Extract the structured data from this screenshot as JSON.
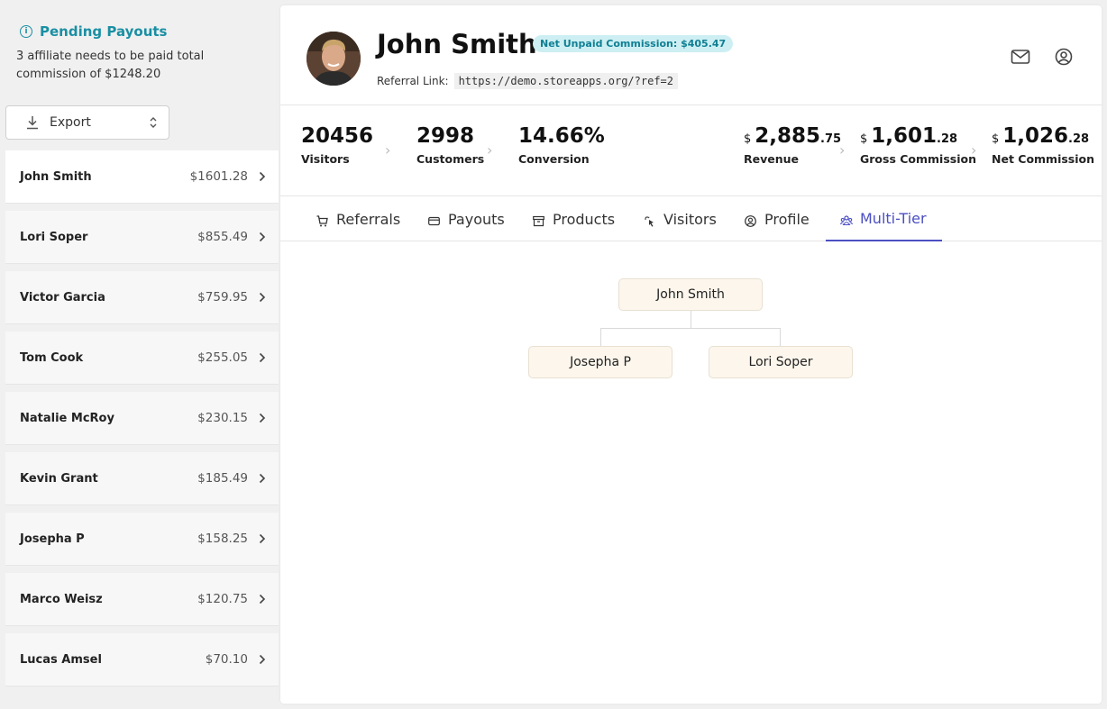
{
  "sidebar": {
    "pending_title": "Pending Payouts",
    "pending_desc": "3 affiliate needs to be paid total commission of $1248.20",
    "export_label": "Export",
    "affiliates": [
      {
        "name": "John Smith",
        "amount": "$1601.28"
      },
      {
        "name": "Lori Soper",
        "amount": "$855.49"
      },
      {
        "name": "Victor Garcia",
        "amount": "$759.95"
      },
      {
        "name": "Tom Cook",
        "amount": "$255.05"
      },
      {
        "name": "Natalie McRoy",
        "amount": "$230.15"
      },
      {
        "name": "Kevin Grant",
        "amount": "$185.49"
      },
      {
        "name": "Josepha P",
        "amount": "$158.25"
      },
      {
        "name": "Marco Weisz",
        "amount": "$120.75"
      },
      {
        "name": "Lucas Amsel",
        "amount": "$70.10"
      }
    ]
  },
  "header": {
    "name": "John Smith",
    "badge": "Net Unpaid Commission: $405.47",
    "ref_label": "Referral Link:",
    "ref_link": "https://demo.storeapps.org/?ref=2"
  },
  "stats": {
    "visitors": {
      "value": "20456",
      "label": "Visitors"
    },
    "customers": {
      "value": "2998",
      "label": "Customers"
    },
    "conversion": {
      "value": "14.66%",
      "label": "Conversion"
    },
    "revenue": {
      "currency": "$",
      "whole": "2,885",
      "cents": ".75",
      "label": "Revenue"
    },
    "gross": {
      "currency": "$",
      "whole": "1,601",
      "cents": ".28",
      "label": "Gross Commission"
    },
    "net": {
      "currency": "$",
      "whole": "1,026",
      "cents": ".28",
      "label": "Net Commission"
    }
  },
  "tabs": {
    "referrals": "Referrals",
    "payouts": "Payouts",
    "products": "Products",
    "visitors": "Visitors",
    "profile": "Profile",
    "multitier": "Multi-Tier"
  },
  "tree": {
    "root": "John Smith",
    "children": [
      "Josepha P",
      "Lori Soper"
    ]
  },
  "colors": {
    "accent": "#4b4fc2",
    "teal": "#1a8fa3",
    "badge_bg": "#cdeff3",
    "node_bg": "#fcf6ec"
  }
}
